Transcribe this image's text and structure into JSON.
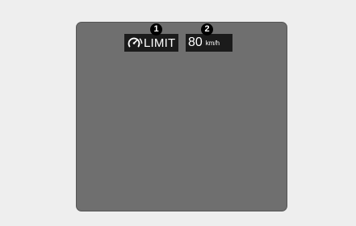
{
  "display": {
    "limit_indicator": {
      "icon": "speedometer-limit-icon",
      "label": "LIMIT"
    },
    "speed_indicator": {
      "value": "80",
      "unit": "km/h"
    }
  },
  "callouts": {
    "first": "1",
    "second": "2"
  }
}
